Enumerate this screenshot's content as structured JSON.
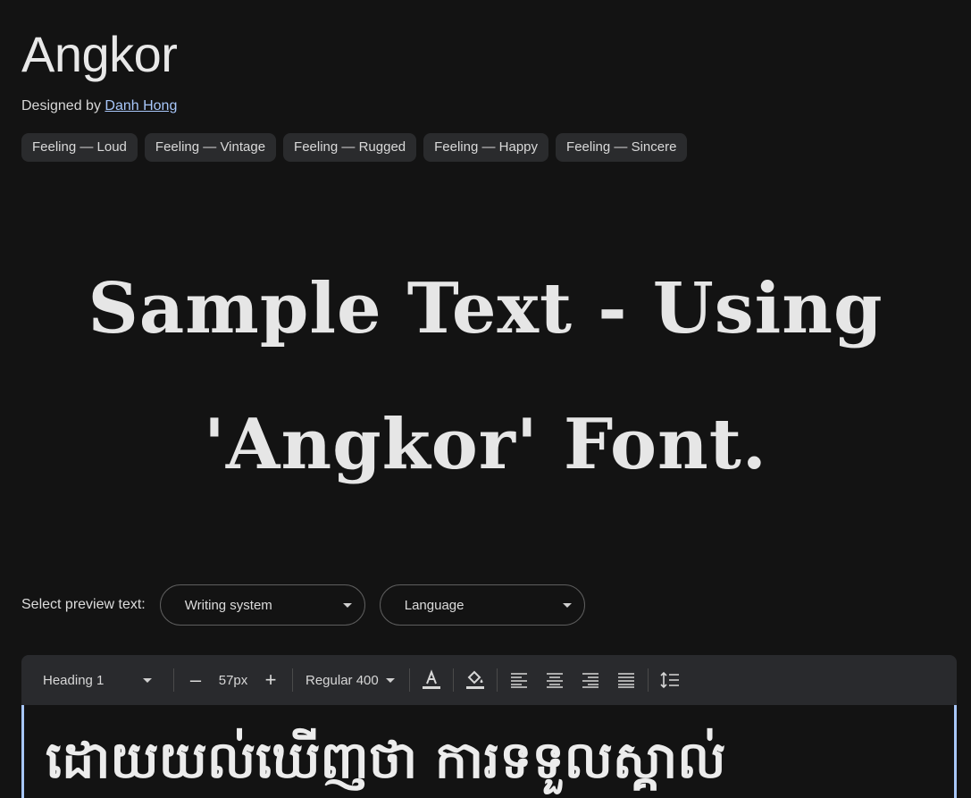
{
  "header": {
    "title": "Angkor",
    "designed_by_label": "Designed by",
    "designer": "Danh Hong"
  },
  "tags": [
    "Feeling — Loud",
    "Feeling — Vintage",
    "Feeling — Rugged",
    "Feeling — Happy",
    "Feeling — Sincere"
  ],
  "sample": {
    "line1": "Sample Text - Using",
    "line2": "'Angkor' Font."
  },
  "preview": {
    "label": "Select preview text:",
    "writing_system": "Writing system",
    "language": "Language"
  },
  "toolbar": {
    "style": "Heading 1",
    "minus": "–",
    "size": "57px",
    "plus": "+",
    "weight": "Regular 400"
  },
  "editor": {
    "text": "ដោយយល់ឃើញថា ការទទួលស្គាល់"
  }
}
